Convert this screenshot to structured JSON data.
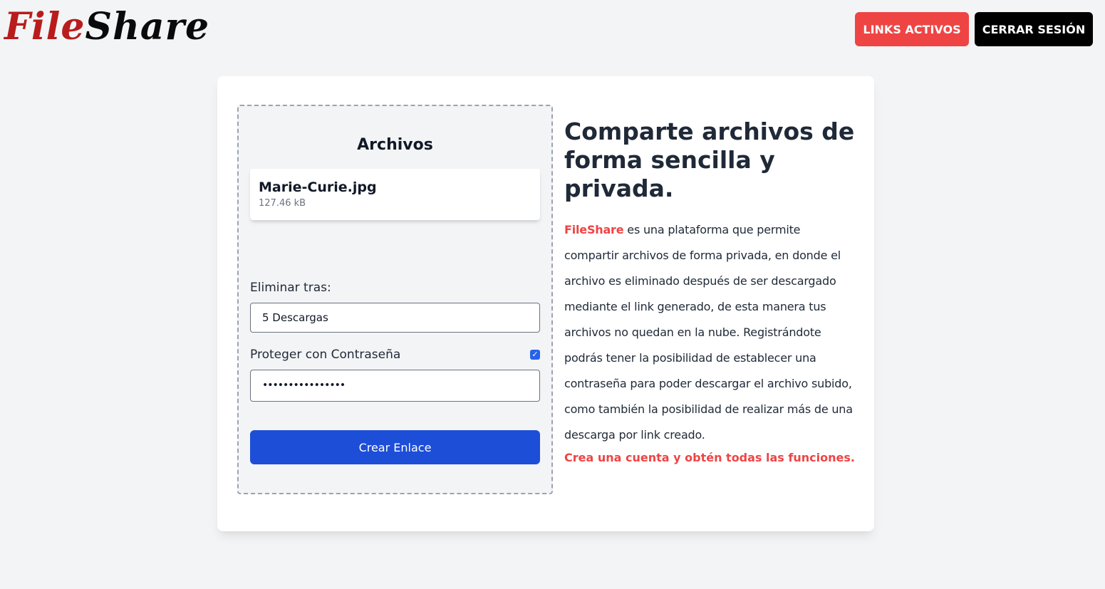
{
  "header": {
    "logo_part1": "File",
    "logo_part2": "Share",
    "links_button": "LINKS ACTIVOS",
    "logout_button": "CERRAR SESIÓN"
  },
  "upload": {
    "title": "Archivos",
    "file": {
      "name": "Marie-Curie.jpg",
      "size": "127.46 kB"
    },
    "delete_after_label": "Eliminar tras:",
    "delete_after_value": "5 Descargas",
    "password_label": "Proteger con Contraseña",
    "password_checked": true,
    "password_value": "••••••••••••••••",
    "create_button": "Crear Enlace"
  },
  "info": {
    "heading": "Comparte archivos de forma sencilla y privada.",
    "brand": "FileShare",
    "body": "es una plataforma que permite compartir archivos de forma privada, en donde el archivo es eliminado después de ser descargado mediante el link generado, de esta manera tus archivos no quedan en la nube. Registrándote podrás tener la posibilidad de establecer una contraseña para poder descargar el archivo subido, como también la posibilidad de realizar más de una descarga por link creado.",
    "cta": "Crea una cuenta y obtén todas las funciones."
  },
  "colors": {
    "background": "#f3f4f6",
    "logo_red": "#b91c1c",
    "accent_red": "#ef4444",
    "primary_blue": "#1d4ed8",
    "black": "#000000"
  }
}
